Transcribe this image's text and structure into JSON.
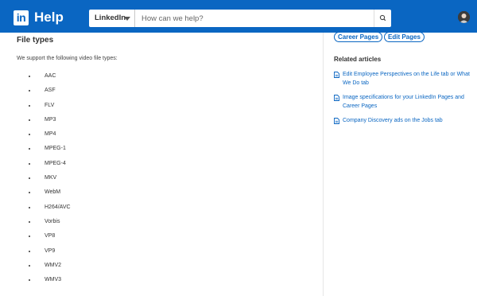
{
  "header": {
    "logo_text": "in",
    "title": "Help",
    "search": {
      "scope": "LinkedIn",
      "placeholder": "How can we help?"
    },
    "icons": {
      "search": "search-icon",
      "avatar": "avatar",
      "scope_caret": "caret-down-icon"
    },
    "brand_color": "#0a66c2"
  },
  "main": {
    "title": "File types",
    "intro": "We support the following video file types:",
    "file_types": [
      "AAC",
      "ASF",
      "FLV",
      "MP3",
      "MP4",
      "MPEG-1",
      "MPEG-4",
      "MKV",
      "WebM",
      "H264/AVC",
      "Vorbis",
      "VP8",
      "VP9",
      "WMV2",
      "WMV3"
    ]
  },
  "sidebar": {
    "tags": [
      "Career Pages",
      "Edit Pages"
    ],
    "related_heading": "Related articles",
    "articles": [
      "Edit Employee Perspectives on the Life tab or What We Do tab",
      "Image specifications for your LinkedIn Pages and Career Pages",
      "Company Discovery ads on the Jobs tab"
    ],
    "article_icon": "document-icon"
  }
}
